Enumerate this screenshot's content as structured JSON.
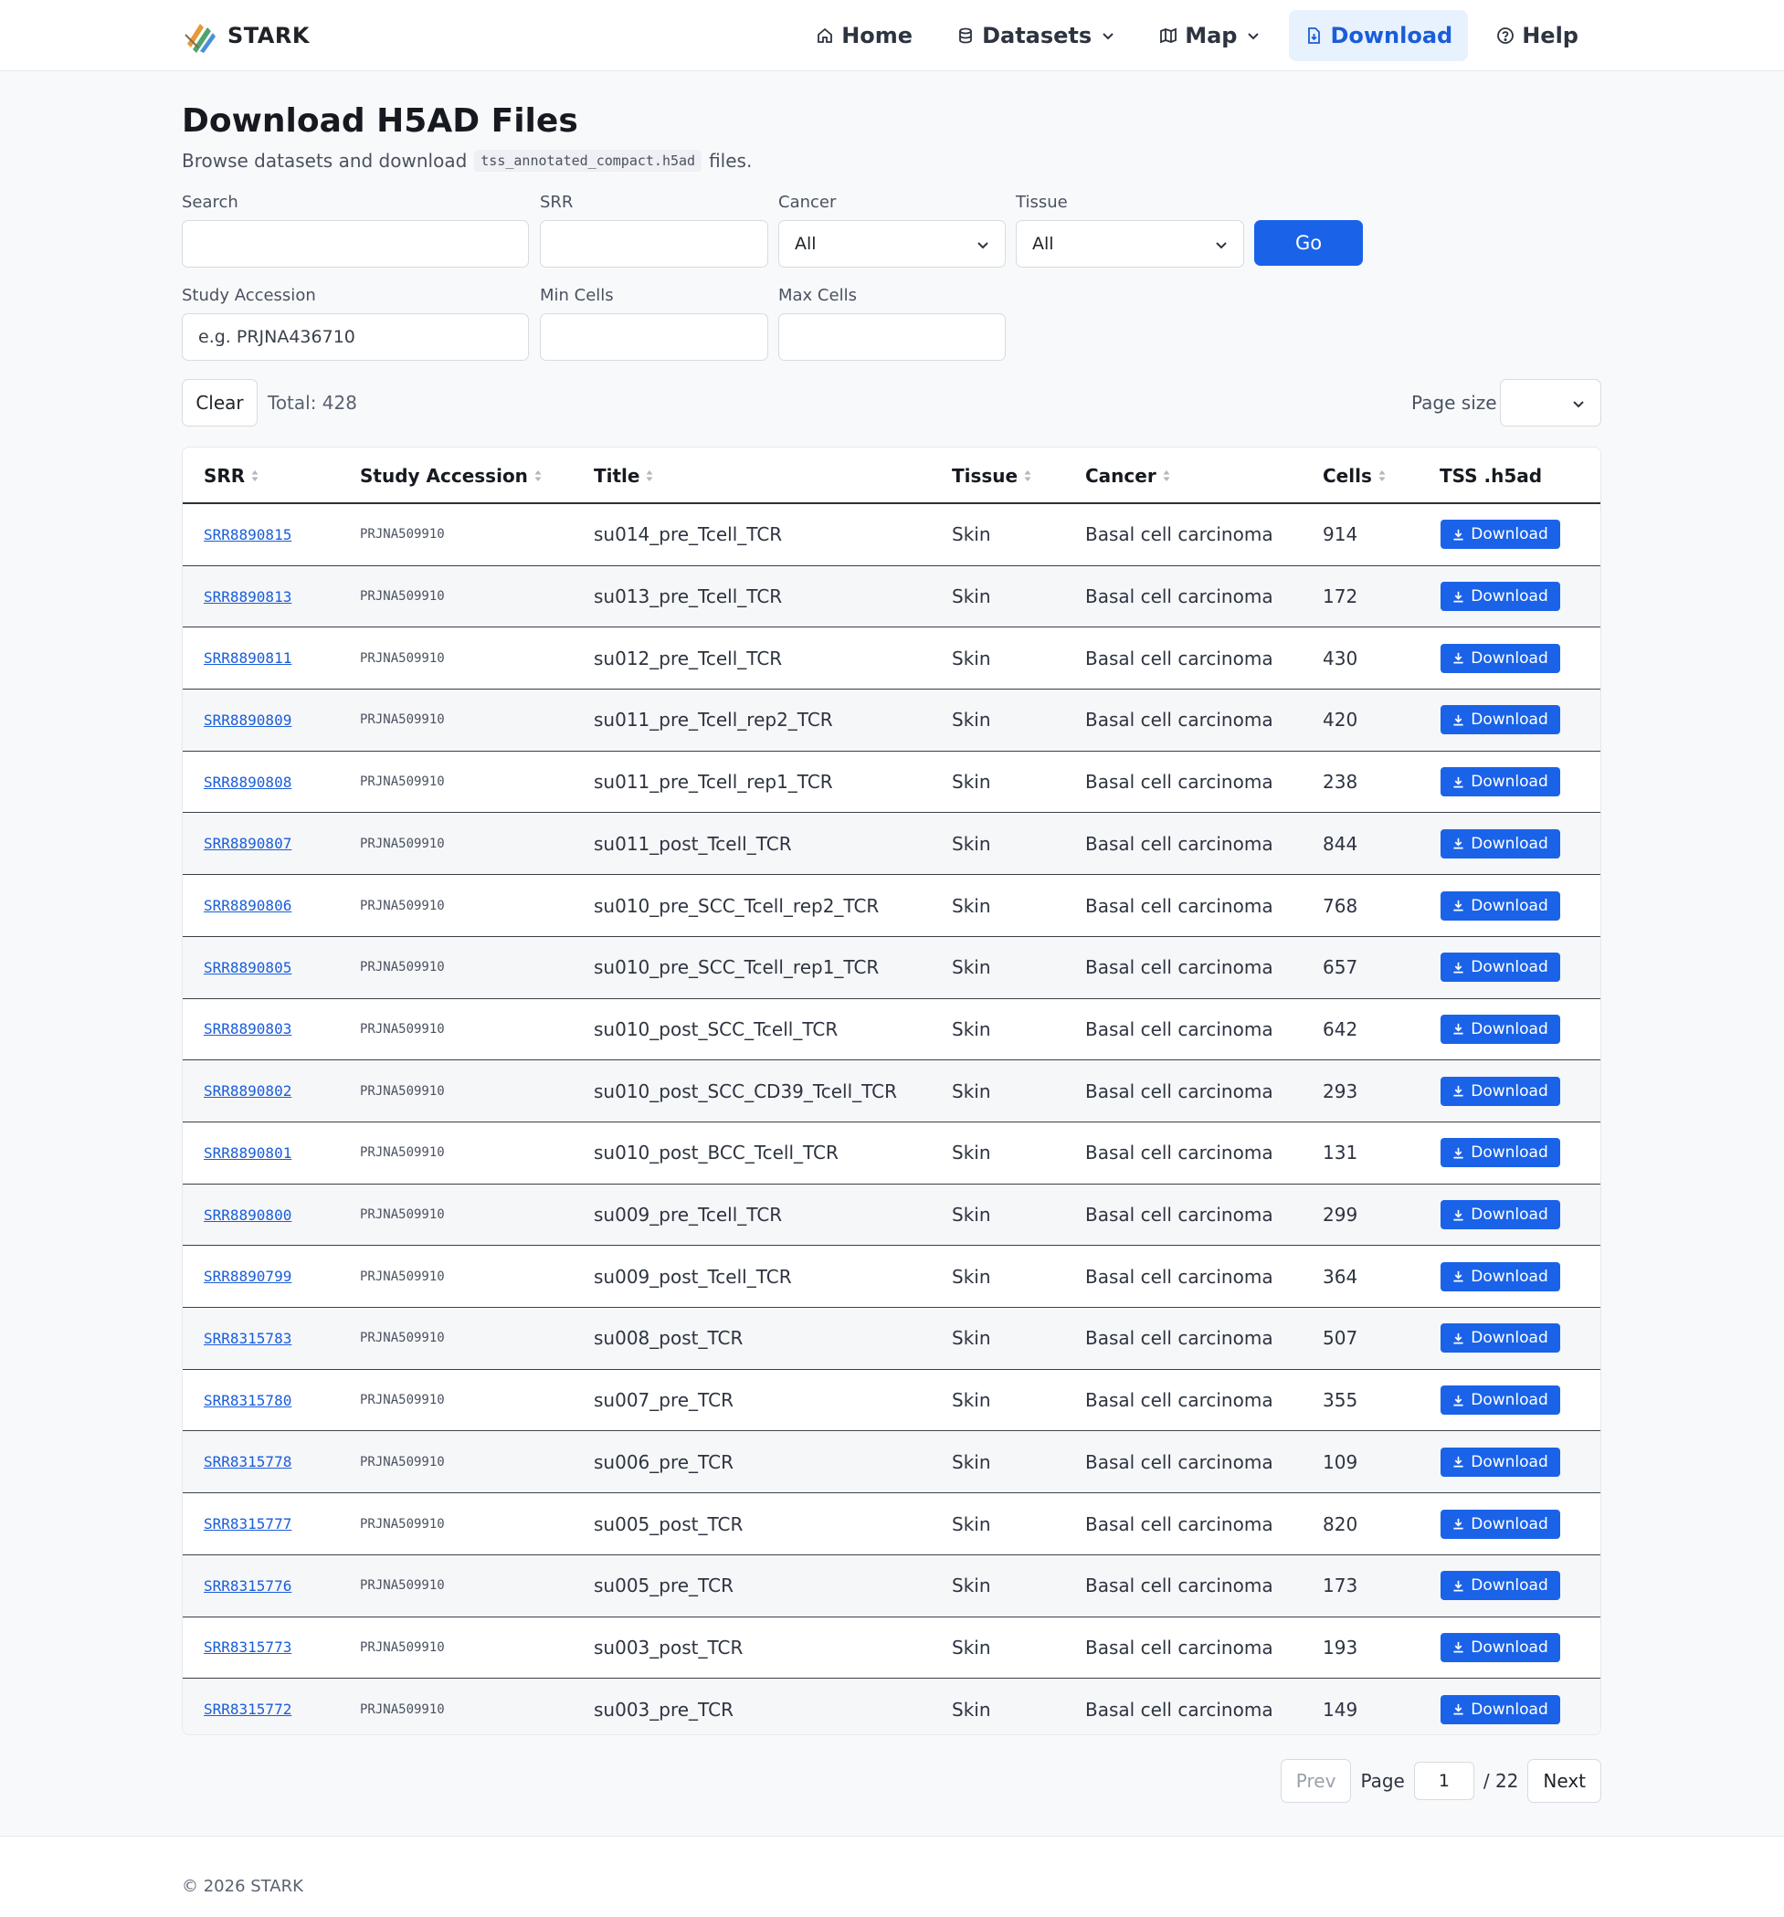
{
  "brand": {
    "name": "STARK"
  },
  "nav": {
    "home": "Home",
    "datasets": "Datasets",
    "map": "Map",
    "download": "Download",
    "help": "Help"
  },
  "page": {
    "title": "Download H5AD Files",
    "subtitle_before": "Browse datasets and download",
    "subtitle_code": "tss_annotated_compact.h5ad",
    "subtitle_after": "files."
  },
  "filters": {
    "search_label": "Search",
    "srr_label": "SRR",
    "cancer_label": "Cancer",
    "cancer_value": "All",
    "tissue_label": "Tissue",
    "tissue_value": "All",
    "go_label": "Go",
    "study_label": "Study Accession",
    "study_placeholder": "e.g. PRJNA436710",
    "min_label": "Min Cells",
    "max_label": "Max Cells"
  },
  "toolbar": {
    "clear_label": "Clear",
    "total": "Total: 428",
    "page_size_label": "Page size"
  },
  "table": {
    "headers": {
      "srr": "SRR",
      "study": "Study Accession",
      "title": "Title",
      "tissue": "Tissue",
      "cancer": "Cancer",
      "cells": "Cells",
      "tss": "TSS .h5ad"
    },
    "download_label": "Download",
    "rows": [
      {
        "srr": "SRR8890815",
        "study": "PRJNA509910",
        "title": "su014_pre_Tcell_TCR",
        "tissue": "Skin",
        "cancer": "Basal cell carcinoma",
        "cells": "914"
      },
      {
        "srr": "SRR8890813",
        "study": "PRJNA509910",
        "title": "su013_pre_Tcell_TCR",
        "tissue": "Skin",
        "cancer": "Basal cell carcinoma",
        "cells": "172"
      },
      {
        "srr": "SRR8890811",
        "study": "PRJNA509910",
        "title": "su012_pre_Tcell_TCR",
        "tissue": "Skin",
        "cancer": "Basal cell carcinoma",
        "cells": "430"
      },
      {
        "srr": "SRR8890809",
        "study": "PRJNA509910",
        "title": "su011_pre_Tcell_rep2_TCR",
        "tissue": "Skin",
        "cancer": "Basal cell carcinoma",
        "cells": "420"
      },
      {
        "srr": "SRR8890808",
        "study": "PRJNA509910",
        "title": "su011_pre_Tcell_rep1_TCR",
        "tissue": "Skin",
        "cancer": "Basal cell carcinoma",
        "cells": "238"
      },
      {
        "srr": "SRR8890807",
        "study": "PRJNA509910",
        "title": "su011_post_Tcell_TCR",
        "tissue": "Skin",
        "cancer": "Basal cell carcinoma",
        "cells": "844"
      },
      {
        "srr": "SRR8890806",
        "study": "PRJNA509910",
        "title": "su010_pre_SCC_Tcell_rep2_TCR",
        "tissue": "Skin",
        "cancer": "Basal cell carcinoma",
        "cells": "768"
      },
      {
        "srr": "SRR8890805",
        "study": "PRJNA509910",
        "title": "su010_pre_SCC_Tcell_rep1_TCR",
        "tissue": "Skin",
        "cancer": "Basal cell carcinoma",
        "cells": "657"
      },
      {
        "srr": "SRR8890803",
        "study": "PRJNA509910",
        "title": "su010_post_SCC_Tcell_TCR",
        "tissue": "Skin",
        "cancer": "Basal cell carcinoma",
        "cells": "642"
      },
      {
        "srr": "SRR8890802",
        "study": "PRJNA509910",
        "title": "su010_post_SCC_CD39_Tcell_TCR",
        "tissue": "Skin",
        "cancer": "Basal cell carcinoma",
        "cells": "293"
      },
      {
        "srr": "SRR8890801",
        "study": "PRJNA509910",
        "title": "su010_post_BCC_Tcell_TCR",
        "tissue": "Skin",
        "cancer": "Basal cell carcinoma",
        "cells": "131"
      },
      {
        "srr": "SRR8890800",
        "study": "PRJNA509910",
        "title": "su009_pre_Tcell_TCR",
        "tissue": "Skin",
        "cancer": "Basal cell carcinoma",
        "cells": "299"
      },
      {
        "srr": "SRR8890799",
        "study": "PRJNA509910",
        "title": "su009_post_Tcell_TCR",
        "tissue": "Skin",
        "cancer": "Basal cell carcinoma",
        "cells": "364"
      },
      {
        "srr": "SRR8315783",
        "study": "PRJNA509910",
        "title": "su008_post_TCR",
        "tissue": "Skin",
        "cancer": "Basal cell carcinoma",
        "cells": "507"
      },
      {
        "srr": "SRR8315780",
        "study": "PRJNA509910",
        "title": "su007_pre_TCR",
        "tissue": "Skin",
        "cancer": "Basal cell carcinoma",
        "cells": "355"
      },
      {
        "srr": "SRR8315778",
        "study": "PRJNA509910",
        "title": "su006_pre_TCR",
        "tissue": "Skin",
        "cancer": "Basal cell carcinoma",
        "cells": "109"
      },
      {
        "srr": "SRR8315777",
        "study": "PRJNA509910",
        "title": "su005_post_TCR",
        "tissue": "Skin",
        "cancer": "Basal cell carcinoma",
        "cells": "820"
      },
      {
        "srr": "SRR8315776",
        "study": "PRJNA509910",
        "title": "su005_pre_TCR",
        "tissue": "Skin",
        "cancer": "Basal cell carcinoma",
        "cells": "173"
      },
      {
        "srr": "SRR8315773",
        "study": "PRJNA509910",
        "title": "su003_post_TCR",
        "tissue": "Skin",
        "cancer": "Basal cell carcinoma",
        "cells": "193"
      },
      {
        "srr": "SRR8315772",
        "study": "PRJNA509910",
        "title": "su003_pre_TCR",
        "tissue": "Skin",
        "cancer": "Basal cell carcinoma",
        "cells": "149"
      }
    ]
  },
  "pagination": {
    "prev": "Prev",
    "page_label": "Page",
    "current": "1",
    "total": "/ 22",
    "next": "Next"
  },
  "footer": {
    "copyright": "© 2026 STARK"
  },
  "icons": {
    "brand": "stark-logo-icon",
    "home": "home-icon",
    "datasets": "database-icon",
    "map": "map-icon",
    "download": "file-download-icon",
    "help": "help-circle-icon"
  },
  "colors": {
    "primary": "#1a63e8",
    "nav_active_bg": "#e8f1fe",
    "link": "#1a5dd9"
  }
}
